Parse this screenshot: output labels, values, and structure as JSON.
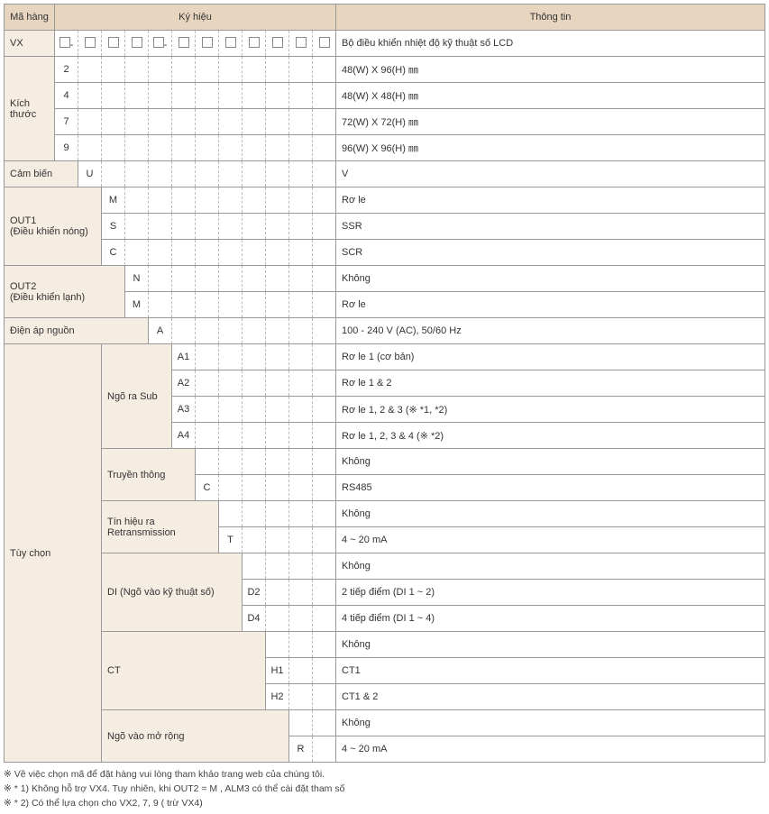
{
  "headers": {
    "item": "Mã hàng",
    "symbol": "Ký hiệu",
    "info": "Thông tin"
  },
  "vx": {
    "label": "VX",
    "info": "Bộ điều khiển nhiệt độ kỹ thuật số LCD"
  },
  "size": {
    "label": "Kích thước",
    "rows": [
      {
        "c": "2",
        "info": "48(W)  X  96(H)  ㎜"
      },
      {
        "c": "4",
        "info": "48(W)  X  48(H)  ㎜"
      },
      {
        "c": "7",
        "info": "72(W)  X  72(H)  ㎜"
      },
      {
        "c": "9",
        "info": "96(W)  X  96(H)  ㎜"
      }
    ]
  },
  "sensor": {
    "label": "Cảm biến",
    "c": "U",
    "info": "V"
  },
  "out1": {
    "label": "OUT1\n(Điều khiển nóng)",
    "rows": [
      {
        "c": "M",
        "info": "Rơ le"
      },
      {
        "c": "S",
        "info": "SSR"
      },
      {
        "c": "C",
        "info": "SCR"
      }
    ]
  },
  "out2": {
    "label": "OUT2\n(Điều khiển lạnh)",
    "rows": [
      {
        "c": "N",
        "info": "Không"
      },
      {
        "c": "M",
        "info": "Rơ le"
      }
    ]
  },
  "power": {
    "label": "Điện áp nguồn",
    "c": "A",
    "info": "100 - 240 V (AC), 50/60 Hz"
  },
  "option": {
    "label": "Tùy chọn",
    "sub": {
      "label": "Ngõ ra Sub",
      "rows": [
        {
          "c": "A1",
          "info": "Rơ le 1 (cơ bản)"
        },
        {
          "c": "A2",
          "info": "Rơ le 1 & 2"
        },
        {
          "c": "A3",
          "info": "Rơ le 1, 2 & 3 (※ *1, *2)"
        },
        {
          "c": "A4",
          "info": "Rơ le 1, 2, 3 & 4 (※ *2)"
        }
      ]
    },
    "comm": {
      "label": "Truyền thông",
      "rows": [
        {
          "c": "",
          "info": "Không"
        },
        {
          "c": "C",
          "info": "RS485"
        }
      ]
    },
    "retrans": {
      "label": "Tín hiệu ra Retransmission",
      "rows": [
        {
          "c": "",
          "info": "Không"
        },
        {
          "c": "T",
          "info": "4 ~ 20 mA"
        }
      ]
    },
    "di": {
      "label": "DI (Ngõ vào kỹ thuật số)",
      "rows": [
        {
          "c": "",
          "info": "Không"
        },
        {
          "c": "D2",
          "info": "2 tiếp điểm (DI 1 ~ 2)"
        },
        {
          "c": "D4",
          "info": "4 tiếp điểm (DI 1 ~ 4)"
        }
      ]
    },
    "ct": {
      "label": "CT",
      "rows": [
        {
          "c": "",
          "info": "Không"
        },
        {
          "c": "H1",
          "info": "CT1"
        },
        {
          "c": "H2",
          "info": "CT1 & 2"
        }
      ]
    },
    "ext": {
      "label": "Ngõ vào mở rộng",
      "rows": [
        {
          "c": "",
          "info": "Không"
        },
        {
          "c": "R",
          "info": "4 ~ 20 mA"
        }
      ]
    }
  },
  "notes": {
    "n0": "※ Về việc chọn mã để đặt hàng vui lòng tham khảo trang web của chúng tôi.",
    "n1": "※ * 1) Không hỗ trợ VX4. Tuy nhiên, khi OUT2 = M , ALM3 có thể cài đặt tham số",
    "n2": "※ * 2) Có thể lựa chọn cho VX2, 7, 9 ( trừ VX4)"
  },
  "dash": "-"
}
